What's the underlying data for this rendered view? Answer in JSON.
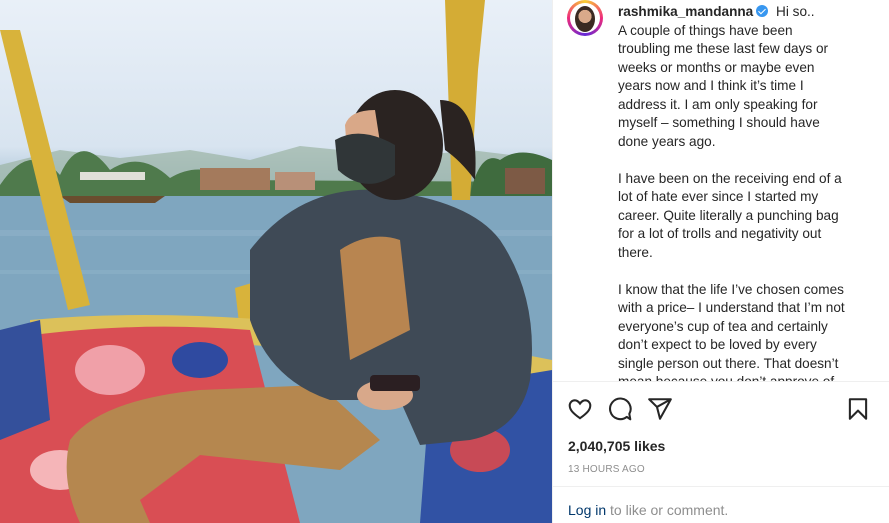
{
  "post": {
    "username": "rashmika_mandanna",
    "verified": true,
    "caption_lead": "Hi so..",
    "caption_paragraphs": [
      "A couple of things have been troubling me these last few days or weeks or months or maybe even years now and I think it’s time I address it. I am only speaking for myself – something I should have done years ago.",
      "I have been on the receiving end of a lot of hate ever since I started my career. Quite literally a punching bag for a lot of trolls and negativity out there.",
      "I know that the life I’ve chosen comes with a price– I understand that I’m not everyone’s cup of tea and certainly don’t expect to be loved by every single person out there. That doesn’t mean because you don’t approve of"
    ],
    "likes": "2,040,705 likes",
    "timestamp": "13 HOURS AGO",
    "login_link": "Log in",
    "login_rest": " to like or comment."
  },
  "icons": {
    "like": "heart-icon",
    "comment": "comment-icon",
    "share": "paper-plane-icon",
    "save": "bookmark-icon",
    "verified": "verified-badge-icon"
  },
  "colors": {
    "text": "#262626",
    "secondary": "#8e8e8e",
    "link": "#00376b",
    "verified": "#3897f0",
    "divider": "#efefef"
  }
}
